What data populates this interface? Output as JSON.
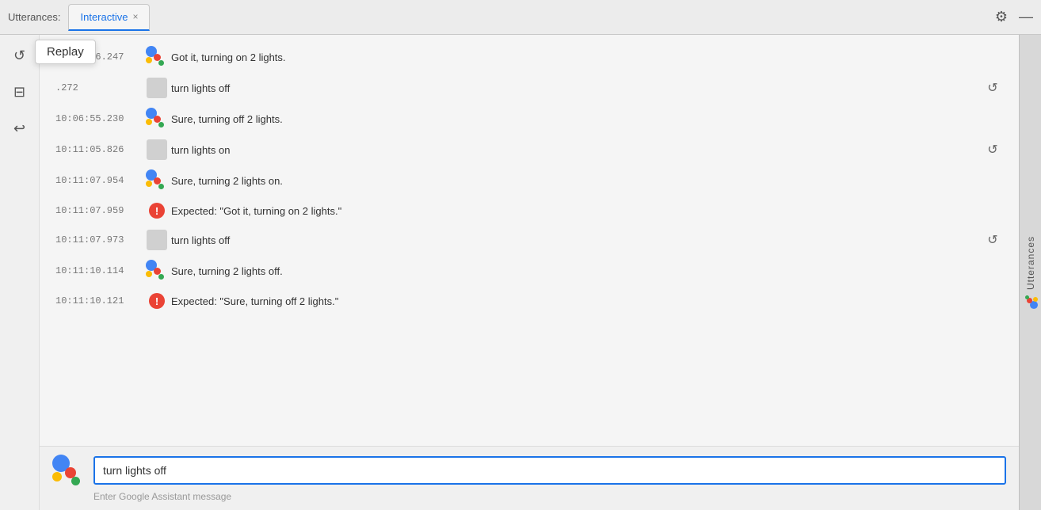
{
  "titleBar": {
    "utterancesLabel": "Utterances:",
    "activeTab": "Interactive",
    "tabCloseSymbol": "×",
    "gearIcon": "⚙",
    "minimizeIcon": "—"
  },
  "toolbar": {
    "replayIcon": "↺",
    "saveIcon": "⊟",
    "undoIcon": "↩",
    "replayTooltip": "Replay"
  },
  "messages": [
    {
      "timestamp": "10:04:36.247",
      "type": "assistant",
      "text": "Got it, turning on 2 lights."
    },
    {
      "timestamp": ".272",
      "type": "user",
      "text": "turn lights off",
      "hasReplay": true
    },
    {
      "timestamp": "10:06:55.230",
      "type": "assistant",
      "text": "Sure, turning off 2 lights."
    },
    {
      "timestamp": "10:11:05.826",
      "type": "user",
      "text": "turn lights on",
      "hasReplay": true
    },
    {
      "timestamp": "10:11:07.954",
      "type": "assistant",
      "text": "Sure, turning 2 lights on."
    },
    {
      "timestamp": "10:11:07.959",
      "type": "error",
      "text": "Expected: \"Got it, turning on 2 lights.\""
    },
    {
      "timestamp": "10:11:07.973",
      "type": "user",
      "text": "turn lights off",
      "hasReplay": true
    },
    {
      "timestamp": "10:11:10.114",
      "type": "assistant",
      "text": "Sure, turning 2 lights off."
    },
    {
      "timestamp": "10:11:10.121",
      "type": "error",
      "text": "Expected: \"Sure, turning off 2 lights.\""
    }
  ],
  "inputArea": {
    "currentValue": "turn lights off",
    "placeholder": "Enter Google Assistant message",
    "hint": "Enter Google Assistant message"
  },
  "rightSidebar": {
    "label": "Utterances"
  }
}
